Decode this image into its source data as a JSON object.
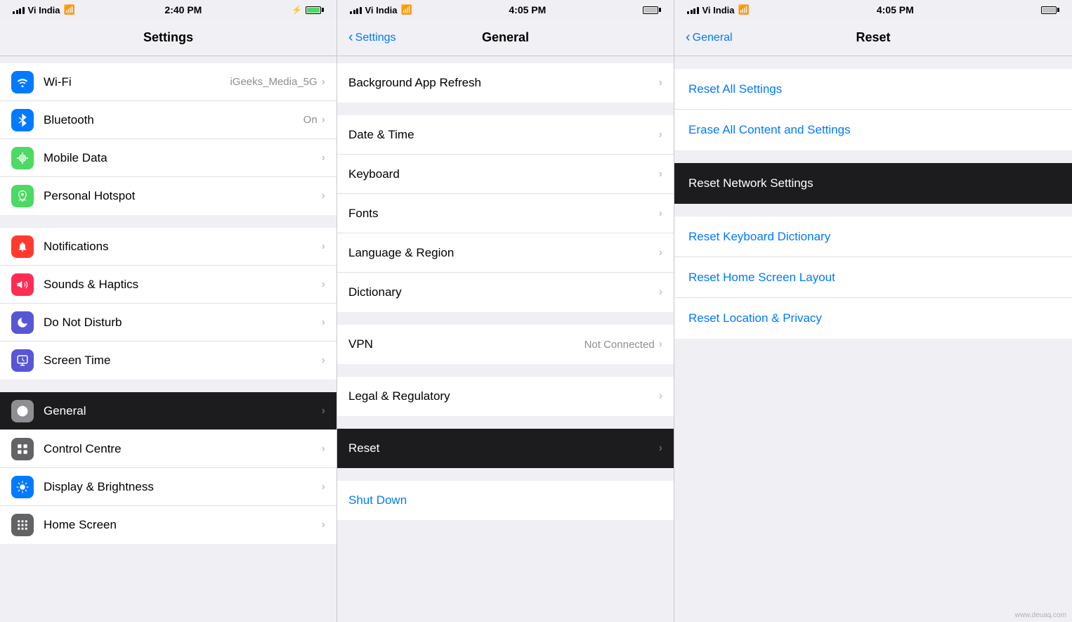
{
  "panels": {
    "left": {
      "status": {
        "carrier": "Vi India",
        "time": "2:40 PM",
        "battery_icon": "battery"
      },
      "title": "Settings",
      "groups": [
        {
          "id": "network",
          "items": [
            {
              "id": "wifi",
              "icon_class": "icon-wifi",
              "icon_char": "📶",
              "icon_unicode": "wifi",
              "label": "Wi-Fi",
              "value": "iGeeks_Media_5G",
              "has_chevron": true
            },
            {
              "id": "bluetooth",
              "icon_class": "icon-bluetooth",
              "icon_char": "🔵",
              "icon_unicode": "bluetooth",
              "label": "Bluetooth",
              "value": "On",
              "has_chevron": true
            },
            {
              "id": "mobile",
              "icon_class": "icon-mobile",
              "icon_char": "📡",
              "icon_unicode": "mobile",
              "label": "Mobile Data",
              "value": "",
              "has_chevron": true
            },
            {
              "id": "hotspot",
              "icon_class": "icon-hotspot",
              "icon_char": "🔗",
              "icon_unicode": "hotspot",
              "label": "Personal Hotspot",
              "value": "",
              "has_chevron": true
            }
          ]
        },
        {
          "id": "system",
          "items": [
            {
              "id": "notifications",
              "icon_class": "icon-notifications",
              "icon_char": "🔔",
              "icon_unicode": "notifications",
              "label": "Notifications",
              "value": "",
              "has_chevron": true
            },
            {
              "id": "sounds",
              "icon_class": "icon-sounds",
              "icon_char": "🔊",
              "icon_unicode": "sounds",
              "label": "Sounds & Haptics",
              "value": "",
              "has_chevron": true
            },
            {
              "id": "dnd",
              "icon_class": "icon-dnd",
              "icon_char": "🌙",
              "icon_unicode": "dnd",
              "label": "Do Not Disturb",
              "value": "",
              "has_chevron": true
            },
            {
              "id": "screentime",
              "icon_class": "icon-screen-time",
              "icon_char": "⌛",
              "icon_unicode": "screentime",
              "label": "Screen Time",
              "value": "",
              "has_chevron": true
            }
          ]
        },
        {
          "id": "general_group",
          "items": [
            {
              "id": "general",
              "icon_class": "icon-general",
              "icon_char": "⚙️",
              "icon_unicode": "general",
              "label": "General",
              "value": "",
              "has_chevron": true,
              "active": true
            },
            {
              "id": "control",
              "icon_class": "icon-control",
              "icon_char": "🎛️",
              "icon_unicode": "control",
              "label": "Control Centre",
              "value": "",
              "has_chevron": true
            },
            {
              "id": "display",
              "icon_class": "icon-display",
              "icon_char": "☀️",
              "icon_unicode": "display",
              "label": "Display & Brightness",
              "value": "",
              "has_chevron": true
            },
            {
              "id": "home",
              "icon_class": "icon-home",
              "icon_char": "⠿",
              "icon_unicode": "home",
              "label": "Home Screen",
              "value": "",
              "has_chevron": true
            }
          ]
        }
      ]
    },
    "middle": {
      "status": {
        "carrier": "Vi India",
        "time": "4:05 PM",
        "battery_icon": "battery"
      },
      "back_label": "Settings",
      "title": "General",
      "groups": [
        {
          "id": "top",
          "items": [
            {
              "id": "bg-refresh",
              "label": "Background App Refresh",
              "value": "",
              "has_chevron": true
            }
          ]
        },
        {
          "id": "datetime",
          "items": [
            {
              "id": "date-time",
              "label": "Date & Time",
              "value": "",
              "has_chevron": true
            },
            {
              "id": "keyboard",
              "label": "Keyboard",
              "value": "",
              "has_chevron": true
            },
            {
              "id": "fonts",
              "label": "Fonts",
              "value": "",
              "has_chevron": true
            },
            {
              "id": "language",
              "label": "Language & Region",
              "value": "",
              "has_chevron": true
            },
            {
              "id": "dictionary",
              "label": "Dictionary",
              "value": "",
              "has_chevron": true
            }
          ]
        },
        {
          "id": "vpn",
          "items": [
            {
              "id": "vpn",
              "label": "VPN",
              "value": "Not Connected",
              "has_chevron": true
            }
          ]
        },
        {
          "id": "legal",
          "items": [
            {
              "id": "legal",
              "label": "Legal & Regulatory",
              "value": "",
              "has_chevron": true
            }
          ]
        },
        {
          "id": "reset_group",
          "items": [
            {
              "id": "reset",
              "label": "Reset",
              "value": "",
              "has_chevron": true,
              "active": true
            }
          ]
        },
        {
          "id": "shutdown_group",
          "items": [
            {
              "id": "shutdown",
              "label": "Shut Down",
              "value": "",
              "has_chevron": false,
              "blue": true
            }
          ]
        }
      ]
    },
    "right": {
      "status": {
        "carrier": "Vi India",
        "time": "4:05 PM",
        "battery_icon": "battery"
      },
      "back_label": "General",
      "title": "Reset",
      "groups": [
        {
          "id": "reset_top",
          "items": [
            {
              "id": "reset-all",
              "label": "Reset All Settings",
              "active": false
            },
            {
              "id": "erase-all",
              "label": "Erase All Content and Settings",
              "active": false
            }
          ]
        },
        {
          "id": "reset_network",
          "items": [
            {
              "id": "reset-network",
              "label": "Reset Network Settings",
              "active": true
            }
          ]
        },
        {
          "id": "reset_others",
          "items": [
            {
              "id": "reset-keyboard",
              "label": "Reset Keyboard Dictionary",
              "active": false
            },
            {
              "id": "reset-home",
              "label": "Reset Home Screen Layout",
              "active": false
            },
            {
              "id": "reset-location",
              "label": "Reset Location & Privacy",
              "active": false
            }
          ]
        }
      ]
    }
  },
  "icons": {
    "wifi_char": "▋▊▉",
    "chevron_char": "›",
    "back_chevron": "‹"
  },
  "watermark": "www.deuaq.com"
}
